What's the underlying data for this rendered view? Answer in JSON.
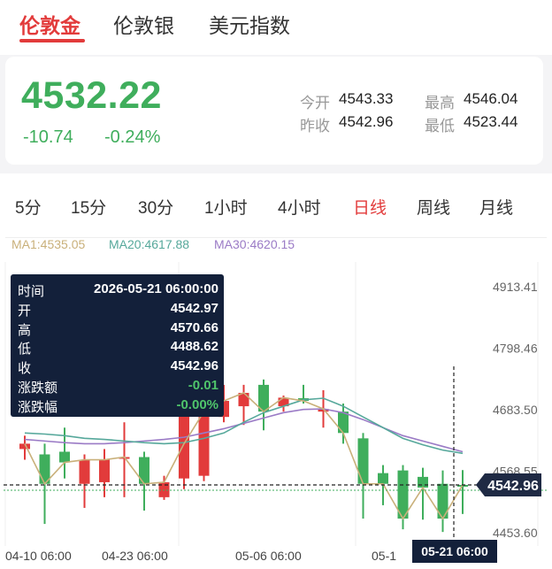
{
  "tabs": [
    {
      "label": "伦敦金",
      "active": true
    },
    {
      "label": "伦敦银",
      "active": false
    },
    {
      "label": "美元指数",
      "active": false
    }
  ],
  "quote": {
    "price": "4532.22",
    "change": "-10.74",
    "change_pct": "-0.24%",
    "open_label": "今开",
    "open": "4543.33",
    "high_label": "最高",
    "high": "4546.04",
    "prev_close_label": "昨收",
    "prev_close": "4542.96",
    "low_label": "最低",
    "low": "4523.44"
  },
  "periods": [
    {
      "label": "5分"
    },
    {
      "label": "15分"
    },
    {
      "label": "30分"
    },
    {
      "label": "1小时"
    },
    {
      "label": "4小时"
    },
    {
      "label": "日线",
      "active": true
    },
    {
      "label": "周线"
    },
    {
      "label": "月线"
    }
  ],
  "ma_labels": {
    "ma1": "MA1:4535.05",
    "ma20": "MA20:4617.88",
    "ma30": "MA30:4620.15"
  },
  "tooltip": {
    "time_label": "时间",
    "time": "2026-05-21 06:00:00",
    "open_label": "开",
    "open": "4542.97",
    "high_label": "高",
    "high": "4570.66",
    "low_label": "低",
    "low": "4488.62",
    "close_label": "收",
    "close": "4542.96",
    "chg_label": "涨跌额",
    "chg": "-0.01",
    "chg_pct_label": "涨跌幅",
    "chg_pct": "-0.00%"
  },
  "colors": {
    "up": "#e23b3b",
    "down": "#3fae5c",
    "ma1": "#c9b07a",
    "ma20": "#56a89b",
    "ma30": "#9b7bc6",
    "tooltip_bg": "#13203a"
  },
  "chart_data": {
    "type": "candlestick",
    "y_ticks": [
      4913.41,
      4798.46,
      4683.5,
      4568.55,
      4453.6
    ],
    "x_tick_labels": [
      "04-10 06:00",
      "04-23 06:00",
      "05-06 06:00",
      "05-1"
    ],
    "crosshair": {
      "x_label": "05-21 06:00",
      "y_label": "4542.96",
      "y_value": 4542.96
    },
    "candles": [
      {
        "o": 4610,
        "h": 4635,
        "l": 4590,
        "c": 4620
      },
      {
        "o": 4600,
        "h": 4620,
        "l": 4470,
        "c": 4545
      },
      {
        "o": 4605,
        "h": 4650,
        "l": 4555,
        "c": 4585
      },
      {
        "o": 4545,
        "h": 4600,
        "l": 4500,
        "c": 4590
      },
      {
        "o": 4548,
        "h": 4610,
        "l": 4520,
        "c": 4590
      },
      {
        "o": 4595,
        "h": 4660,
        "l": 4520,
        "c": 4595
      },
      {
        "o": 4595,
        "h": 4605,
        "l": 4495,
        "c": 4545
      },
      {
        "o": 4520,
        "h": 4560,
        "l": 4515,
        "c": 4548
      },
      {
        "o": 4555,
        "h": 4670,
        "l": 4535,
        "c": 4680
      },
      {
        "o": 4560,
        "h": 4705,
        "l": 4550,
        "c": 4680
      },
      {
        "o": 4670,
        "h": 4730,
        "l": 4660,
        "c": 4700
      },
      {
        "o": 4690,
        "h": 4730,
        "l": 4655,
        "c": 4715
      },
      {
        "o": 4730,
        "h": 4740,
        "l": 4645,
        "c": 4680
      },
      {
        "o": 4690,
        "h": 4710,
        "l": 4680,
        "c": 4706
      },
      {
        "o": 4705,
        "h": 4730,
        "l": 4695,
        "c": 4700
      },
      {
        "o": 4680,
        "h": 4720,
        "l": 4650,
        "c": 4685
      },
      {
        "o": 4680,
        "h": 4695,
        "l": 4620,
        "c": 4640
      },
      {
        "o": 4630,
        "h": 4640,
        "l": 4480,
        "c": 4545
      },
      {
        "o": 4565,
        "h": 4580,
        "l": 4505,
        "c": 4545
      },
      {
        "o": 4570,
        "h": 4580,
        "l": 4460,
        "c": 4480
      },
      {
        "o": 4558,
        "h": 4575,
        "l": 4478,
        "c": 4538
      },
      {
        "o": 4545,
        "h": 4570,
        "l": 4455,
        "c": 4480
      },
      {
        "o": 4542.97,
        "h": 4570.66,
        "l": 4488.62,
        "c": 4542.96
      }
    ],
    "ma1": [
      4620,
      4545,
      4585,
      4590,
      4590,
      4595,
      4545,
      4548,
      4620,
      4680,
      4700,
      4715,
      4680,
      4706,
      4700,
      4685,
      4640,
      4545,
      4545,
      4480,
      4538,
      4480,
      4543
    ],
    "ma20": [
      4640,
      4638,
      4635,
      4630,
      4628,
      4625,
      4622,
      4620,
      4622,
      4630,
      4640,
      4660,
      4678,
      4690,
      4702,
      4705,
      4690,
      4670,
      4650,
      4630,
      4618,
      4608,
      4602
    ],
    "ma30": [
      4628,
      4625,
      4622,
      4620,
      4620,
      4622,
      4625,
      4628,
      4632,
      4640,
      4648,
      4658,
      4668,
      4678,
      4684,
      4685,
      4678,
      4665,
      4650,
      4635,
      4625,
      4615,
      4605
    ]
  }
}
